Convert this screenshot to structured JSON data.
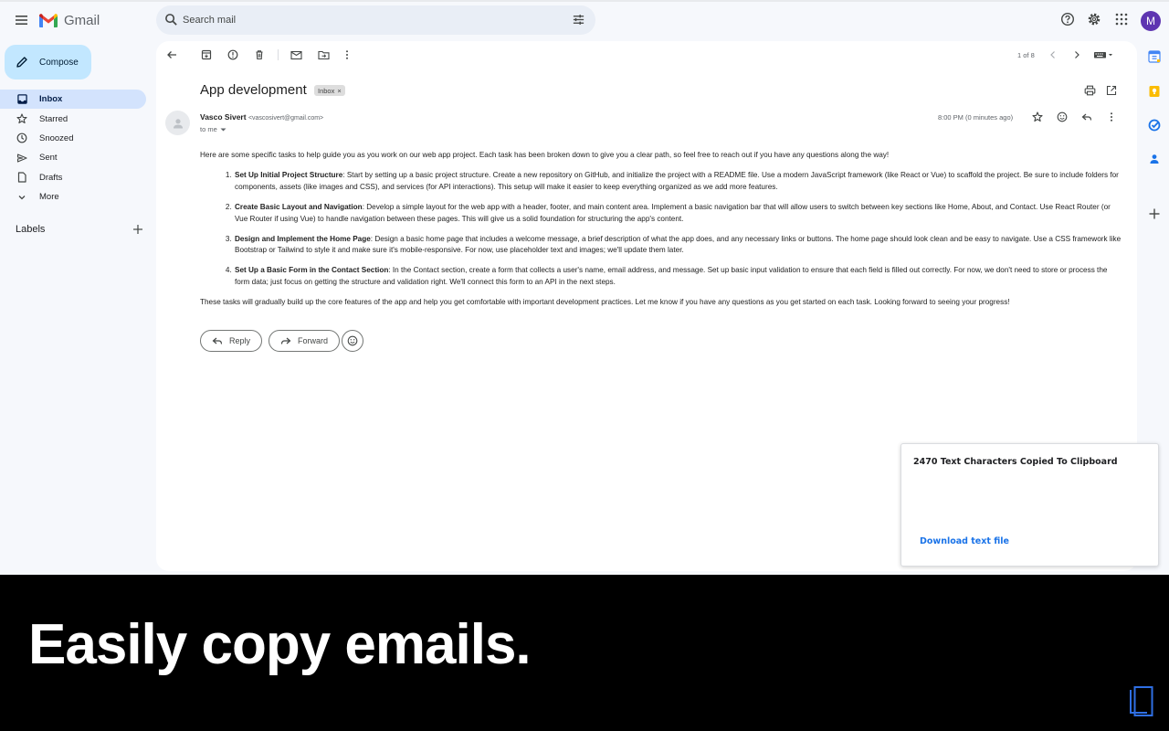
{
  "header": {
    "app_name": "Gmail",
    "search_placeholder": "Search mail",
    "avatar_initial": "M"
  },
  "compose_label": "Compose",
  "sidebar": {
    "items": [
      {
        "label": "Inbox",
        "icon": "inbox-icon",
        "active": true
      },
      {
        "label": "Starred",
        "icon": "star-icon"
      },
      {
        "label": "Snoozed",
        "icon": "clock-icon"
      },
      {
        "label": "Sent",
        "icon": "send-icon"
      },
      {
        "label": "Drafts",
        "icon": "draft-icon"
      },
      {
        "label": "More",
        "icon": "chevron-down-icon"
      }
    ],
    "labels_heading": "Labels"
  },
  "toolbar": {
    "pager": "1 of 8"
  },
  "email": {
    "subject": "App development",
    "chip": "Inbox",
    "sender_name": "Vasco Sivert",
    "sender_email": "<vascosivert@gmail.com>",
    "to": "to me",
    "time": "8:00 PM (0 minutes ago)",
    "intro": "Here are some specific tasks to help guide you as you work on our web app project. Each task has been broken down to give you a clear path, so feel free to reach out if you have any questions along the way!",
    "tasks": [
      {
        "title": "Set Up Initial Project Structure",
        "text": ": Start by setting up a basic project structure. Create a new repository on GitHub, and initialize the project with a README file. Use a modern JavaScript framework (like React or Vue) to scaffold the project. Be sure to include folders for components, assets (like images and CSS), and services (for API interactions). This setup will make it easier to keep everything organized as we add more features."
      },
      {
        "title": "Create Basic Layout and Navigation",
        "text": ": Develop a simple layout for the web app with a header, footer, and main content area. Implement a basic navigation bar that will allow users to switch between key sections like Home, About, and Contact. Use React Router (or Vue Router if using Vue) to handle navigation between these pages. This will give us a solid foundation for structuring the app's content."
      },
      {
        "title": "Design and Implement the Home Page",
        "text": ": Design a basic home page that includes a welcome message, a brief description of what the app does, and any necessary links or buttons. The home page should look clean and be easy to navigate. Use a CSS framework like Bootstrap or Tailwind to style it and make sure it's mobile-responsive. For now, use placeholder text and images; we'll update them later."
      },
      {
        "title": "Set Up a Basic Form in the Contact Section",
        "text": ": In the Contact section, create a form that collects a user's name, email address, and message. Set up basic input validation to ensure that each field is filled out correctly. For now, we don't need to store or process the form data; just focus on getting the structure and validation right. We'll connect this form to an API in the next steps."
      }
    ],
    "outro": "These tasks will gradually build up the core features of the app and help you get comfortable with important development practices. Let me know if you have any questions as you get started on each task. Looking forward to seeing your progress!",
    "reply_label": "Reply",
    "forward_label": "Forward"
  },
  "toast": {
    "title": "2470 Text Characters Copied To Clipboard",
    "link": "Download text file"
  },
  "banner": {
    "headline": "Easily copy emails."
  },
  "colors": {
    "accent": "#1a73e8",
    "compose_bg": "#c2e7ff",
    "active_nav": "#d3e3fd",
    "avatar": "#5e35b1"
  }
}
